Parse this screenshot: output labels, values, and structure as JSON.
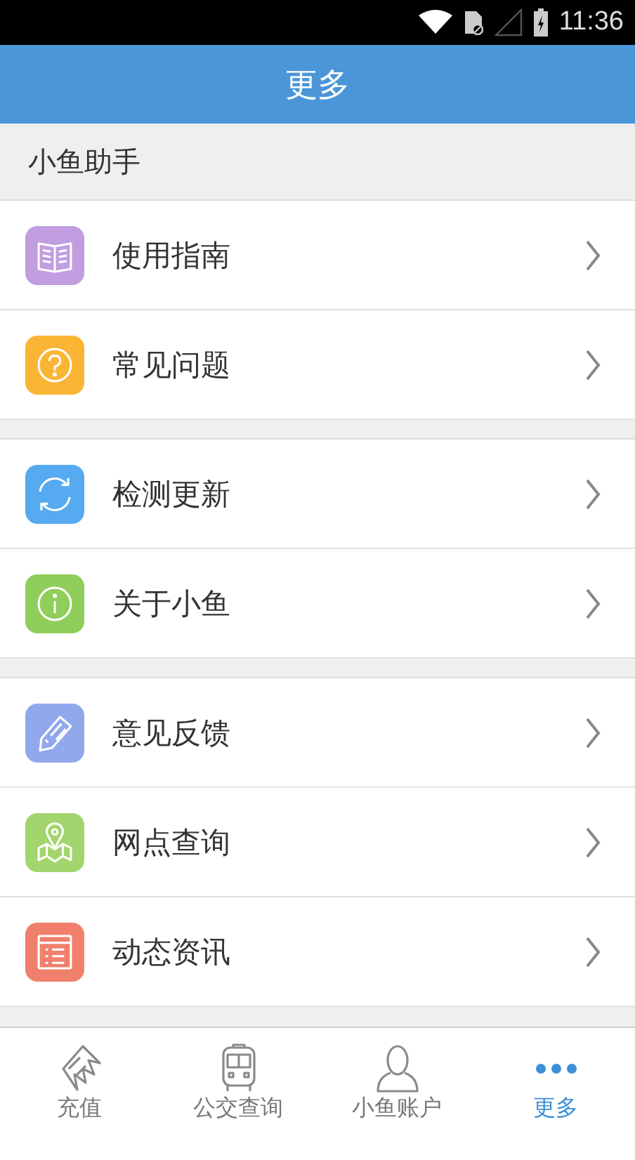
{
  "status_bar": {
    "time": "11:36"
  },
  "header": {
    "title": "更多"
  },
  "groups": [
    {
      "title": "小鱼助手",
      "items": [
        {
          "label": "使用指南",
          "color": "#c09ee0"
        },
        {
          "label": "常见问题",
          "color": "#fbb534"
        }
      ]
    },
    {
      "items": [
        {
          "label": "检测更新",
          "color": "#55aaf0"
        },
        {
          "label": "关于小鱼",
          "color": "#8fce5a"
        }
      ]
    },
    {
      "items": [
        {
          "label": "意见反馈",
          "color": "#92a8ec"
        },
        {
          "label": "网点查询",
          "color": "#a3d56e"
        },
        {
          "label": "动态资讯",
          "color": "#f0806c"
        }
      ]
    }
  ],
  "tabs": [
    {
      "label": "充值",
      "selected": false
    },
    {
      "label": "公交查询",
      "selected": false
    },
    {
      "label": "小鱼账户",
      "selected": false
    },
    {
      "label": "更多",
      "selected": true
    }
  ]
}
